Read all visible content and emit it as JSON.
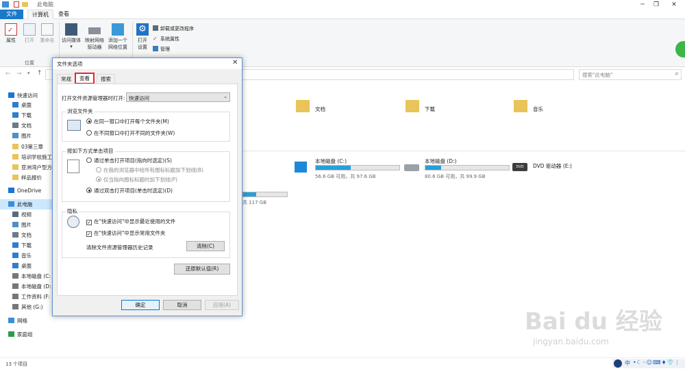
{
  "window": {
    "title": "此电脑"
  },
  "ribbon_tabs": [
    "文件",
    "计算机",
    "查看"
  ],
  "ribbon": {
    "properties": "属性",
    "open": "打开",
    "rename": "重命名",
    "group_location": "位置",
    "access_media": "访问媒体",
    "map_drive_l1": "映射网络",
    "map_drive_l2": "驱动器",
    "add_location_l1": "添加一个",
    "add_location_l2": "网络位置",
    "open_settings_l1": "打开",
    "open_settings_l2": "设置",
    "uninstall": "卸载或更改程序",
    "system_props": "系统属性",
    "manage": "管理"
  },
  "search": {
    "placeholder": "搜索\"此电脑\""
  },
  "nav": [
    {
      "label": "快速访问",
      "icon": "star-icon",
      "color": "#1b75d1"
    },
    {
      "label": "桌面",
      "icon": "desktop-icon",
      "color": "#2b7fd0"
    },
    {
      "label": "下载",
      "icon": "download-icon",
      "color": "#2b7fd0"
    },
    {
      "label": "文档",
      "icon": "document-icon",
      "color": "#6a7b8c"
    },
    {
      "label": "图片",
      "icon": "picture-icon",
      "color": "#4f8fc9"
    },
    {
      "label": "03第三章",
      "icon": "folder-icon",
      "color": "#e8c45a"
    },
    {
      "label": "培训学校施工",
      "icon": "folder-icon",
      "color": "#e8c45a"
    },
    {
      "label": "亚洲湾户型方",
      "icon": "folder-icon",
      "color": "#e8c45a"
    },
    {
      "label": "样品报价",
      "icon": "folder-icon",
      "color": "#e8c45a"
    },
    {
      "label": "OneDrive",
      "icon": "cloud-icon",
      "color": "#1b75d1"
    },
    {
      "label": "此电脑",
      "icon": "computer-icon",
      "color": "#3b8ed8"
    },
    {
      "label": "视频",
      "icon": "video-icon",
      "color": "#5a6a7a"
    },
    {
      "label": "图片",
      "icon": "picture-icon",
      "color": "#4f8fc9"
    },
    {
      "label": "文档",
      "icon": "document-icon",
      "color": "#6a7b8c"
    },
    {
      "label": "下载",
      "icon": "download-icon",
      "color": "#2b7fd0"
    },
    {
      "label": "音乐",
      "icon": "music-icon",
      "color": "#2b7fd0"
    },
    {
      "label": "桌面",
      "icon": "desktop-icon",
      "color": "#2b7fd0"
    },
    {
      "label": "本地磁盘 (C:",
      "icon": "drive-icon",
      "color": "#777"
    },
    {
      "label": "本地磁盘 (D:",
      "icon": "drive-icon",
      "color": "#777"
    },
    {
      "label": "工作资料 (F:",
      "icon": "drive-icon",
      "color": "#777"
    },
    {
      "label": "其他 (G:)",
      "icon": "drive-icon",
      "color": "#777"
    },
    {
      "label": "网络",
      "icon": "network-icon",
      "color": "#3b8ed8"
    },
    {
      "label": "家庭组",
      "icon": "homegroup-icon",
      "color": "#2a9d4a"
    }
  ],
  "folders": [
    {
      "label": "文档"
    },
    {
      "label": "下载"
    },
    {
      "label": "音乐"
    }
  ],
  "drives": [
    {
      "name": "本地磁盘 (C:)",
      "free": "56.6 GB 可用，共 97.6 GB",
      "used_fraction": 0.42
    },
    {
      "name": "本地磁盘 (D:)",
      "free": "80.6 GB 可用，共 99.9 GB",
      "used_fraction": 0.19
    },
    {
      "name": "DVD 驱动器 (E:)"
    }
  ],
  "partial_drive": {
    "text": "共 117 GB",
    "used_fraction": 0.3
  },
  "status": {
    "count": "13 个项目"
  },
  "dialog": {
    "title": "文件夹选项",
    "tabs": [
      "常规",
      "查看",
      "搜索"
    ],
    "open_in_label": "打开文件资源管理器时打开:",
    "open_in_value": "快速访问",
    "browse_group": "浏览文件夹",
    "browse_same": "在同一窗口中打开每个文件夹(M)",
    "browse_new": "在不同窗口中打开不同的文件夹(W)",
    "click_group": "按如下方式单击项目",
    "single_click": "通过单击打开项目(指向时选定)(S)",
    "underline_all": "在我的浏览器中给所有图标标题加下划线(B)",
    "underline_hover": "仅当指向图标标题时加下划线(P)",
    "double_click": "通过双击打开项目(单击时选定)(D)",
    "privacy_group": "隐私",
    "recent_files": "在\"快速访问\"中显示最近使用的文件",
    "frequent_folders": "在\"快速访问\"中显示常用文件夹",
    "clear_history": "清除文件资源管理器历史记录",
    "clear_btn": "清除(C)",
    "restore_btn": "还原默认值(R)",
    "ok_btn": "确定",
    "cancel_btn": "取消",
    "apply_btn": "应用(A)"
  },
  "watermark": {
    "brand": "Bai du 经验",
    "url": "jingyan.baidu.com"
  },
  "tray": {
    "lang": "中"
  }
}
